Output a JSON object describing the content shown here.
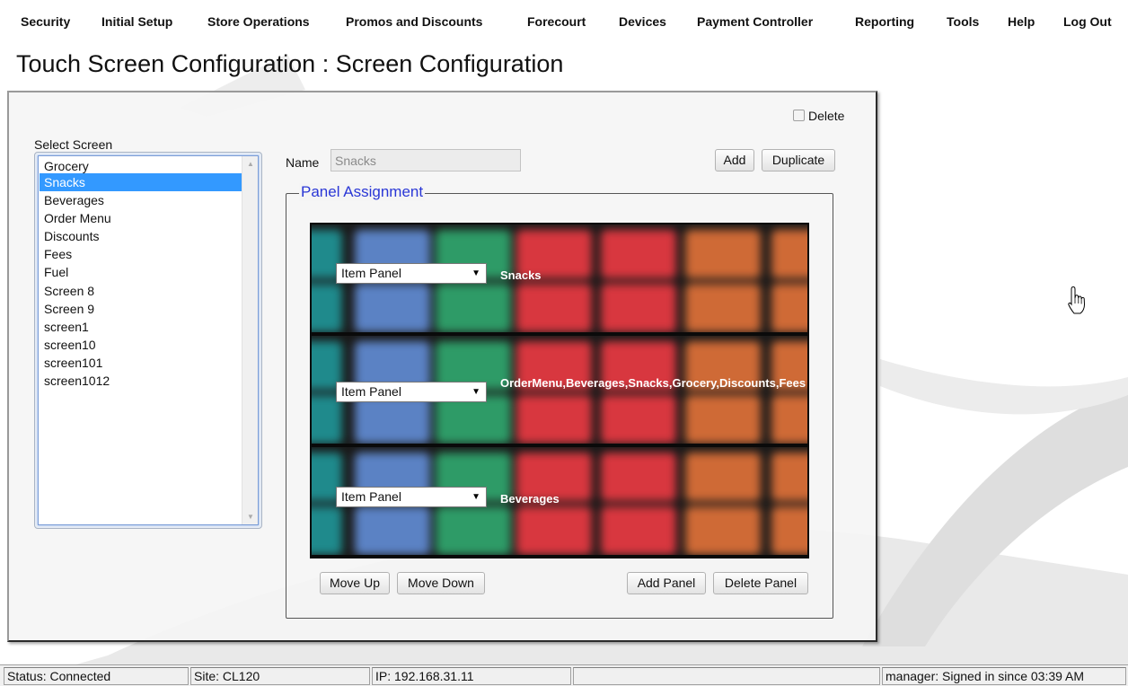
{
  "menu": {
    "items": [
      {
        "label": "Security"
      },
      {
        "label": "Initial Setup"
      },
      {
        "label": "Store Operations"
      },
      {
        "label": "Promos and Discounts"
      },
      {
        "label": "Forecourt"
      },
      {
        "label": "Devices"
      },
      {
        "label": "Payment Controller"
      },
      {
        "label": "Reporting"
      },
      {
        "label": "Tools"
      },
      {
        "label": "Help"
      },
      {
        "label": "Log Out"
      }
    ]
  },
  "page": {
    "title": "Touch Screen Configuration : Screen Configuration"
  },
  "form": {
    "delete_label": "Delete",
    "delete_checked": false,
    "select_screen_label": "Select Screen",
    "screens": [
      {
        "label": "Grocery",
        "selected": false
      },
      {
        "label": "Snacks",
        "selected": true
      },
      {
        "label": "Beverages",
        "selected": false
      },
      {
        "label": "Order Menu",
        "selected": false
      },
      {
        "label": "Discounts",
        "selected": false
      },
      {
        "label": "Fees",
        "selected": false
      },
      {
        "label": "Fuel",
        "selected": false
      },
      {
        "label": "Screen 8",
        "selected": false
      },
      {
        "label": "Screen 9",
        "selected": false
      },
      {
        "label": "screen1",
        "selected": false
      },
      {
        "label": "screen10",
        "selected": false
      },
      {
        "label": "screen101",
        "selected": false
      },
      {
        "label": "screen1012",
        "selected": false
      }
    ],
    "name_label": "Name",
    "name_value": "Snacks",
    "add_label": "Add",
    "duplicate_label": "Duplicate",
    "panel_assignment": {
      "legend": "Panel Assignment",
      "panels": [
        {
          "type": "Item Panel",
          "label": "Snacks"
        },
        {
          "type": "Item Panel",
          "label": "OrderMenu,Beverages,Snacks,Grocery,Discounts,Fees"
        },
        {
          "type": "Item Panel",
          "label": "Beverages"
        }
      ],
      "move_up_label": "Move Up",
      "move_down_label": "Move Down",
      "add_panel_label": "Add Panel",
      "delete_panel_label": "Delete Panel"
    }
  },
  "status": {
    "connection": "Status: Connected",
    "site": "Site: CL120",
    "ip": "IP: 192.168.31.11",
    "user": "manager: Signed in since 03:39 AM"
  },
  "icons": {
    "cursor": "hand-pointer-icon",
    "select_arrow": "dropdown-arrow-icon",
    "checkbox": "checkbox-icon"
  },
  "colors": {
    "selection": "#3399ff",
    "legend": "#2a37d6",
    "tile_teal": "#1f8a8c",
    "tile_blue": "#5b82c4",
    "tile_green": "#2e9b67",
    "tile_red": "#d8373f",
    "tile_orange": "#cf6a36"
  }
}
